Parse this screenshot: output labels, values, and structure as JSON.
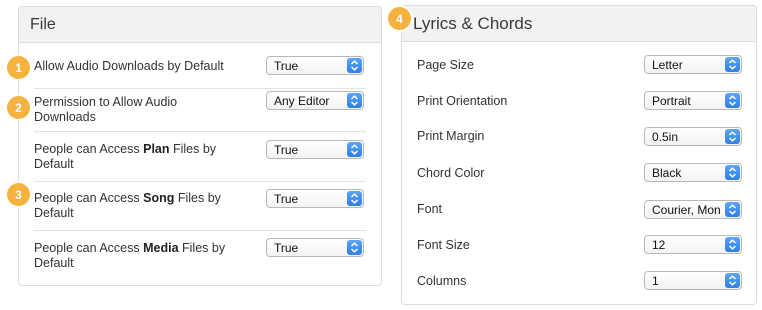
{
  "file_panel": {
    "title": "File",
    "rows": [
      {
        "label_parts": [
          "Allow Audio Downloads by Default"
        ],
        "value": "True"
      },
      {
        "label_parts": [
          "Permission to Allow Audio",
          "Downloads"
        ],
        "value": "Any Editor"
      },
      {
        "label_pre": "People can Access ",
        "label_bold": "Plan",
        "label_post": " Files by",
        "label_line2": "Default",
        "value": "True"
      },
      {
        "label_pre": "People can Access ",
        "label_bold": "Song",
        "label_post": " Files by",
        "label_line2": "Default",
        "value": "True"
      },
      {
        "label_pre": "People can Access ",
        "label_bold": "Media",
        "label_post": " Files by",
        "label_line2": "Default",
        "value": "True"
      }
    ]
  },
  "lyrics_panel": {
    "title": "Lyrics & Chords",
    "rows": [
      {
        "label": "Page Size",
        "value": "Letter"
      },
      {
        "label": "Print Orientation",
        "value": "Portrait"
      },
      {
        "label": "Print Margin",
        "value": "0.5in"
      },
      {
        "label": "Chord Color",
        "value": "Black"
      },
      {
        "label": "Font",
        "value": "Courier, Mon"
      },
      {
        "label": "Font Size",
        "value": "12"
      },
      {
        "label": "Columns",
        "value": "1"
      }
    ]
  },
  "badges": [
    "1",
    "2",
    "3",
    "4"
  ],
  "colors": {
    "badge": "#f5b23e",
    "chevron": "#2f7fe6"
  }
}
